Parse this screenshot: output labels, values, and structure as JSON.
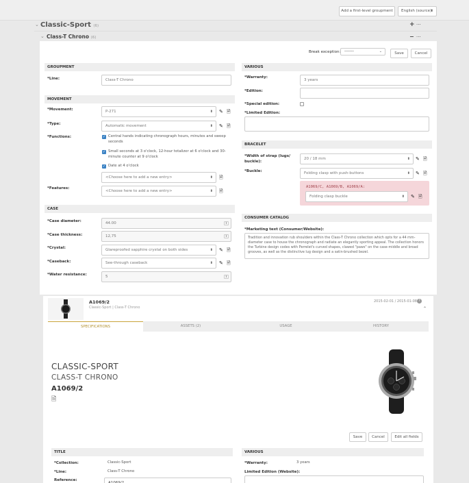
{
  "toolbar": {
    "add_groupment": "Add a first-level groupment",
    "language": "English (source)"
  },
  "tree": {
    "root_label": "Classic-Sport",
    "root_count": "(6)",
    "child_label": "Class-T Chrono",
    "child_count": "(6)",
    "plus": "+",
    "dots": "···",
    "minus": "−"
  },
  "form": {
    "break_exception_label": "Break exception:",
    "break_exception_value": "-------",
    "save": "Save",
    "cancel": "Cancel",
    "groupment": {
      "title": "GROUPMENT",
      "line_label": "*Line:",
      "line_value": "Class-T Chrono"
    },
    "movement": {
      "title": "MOVEMENT",
      "movement_label": "*Movement:",
      "movement_value": "P-271",
      "type_label": "*Type:",
      "type_value": "Automatic movement",
      "functions_label": "*Functions:",
      "functions": [
        "Central hands indicating chronograph hours, minutes and sweep seconds",
        "Small seconds at 3 o'clock, 12-hour totalizer at 6 o'clock and 30-minute counter at 9 o'clock",
        "Date at 4 o'clock"
      ],
      "functions_placeholder": "<Choose here to add a new entry>",
      "features_label": "*Features:",
      "features_placeholder": "<Choose here to add a new entry>"
    },
    "case": {
      "title": "CASE",
      "diameter_label": "*Case diameter:",
      "diameter_value": "44.00",
      "thickness_label": "*Case thickness:",
      "thickness_value": "12,75",
      "crystal_label": "*Crystal:",
      "crystal_value": "Glareproofed sapphire crystal on both sides",
      "caseback_label": "*Caseback:",
      "caseback_value": "See-through caseback",
      "water_label": "*Water resistance:",
      "water_value": "5"
    },
    "various": {
      "title": "VARIOUS",
      "warranty_label": "*Warranty:",
      "warranty_value": "3 years",
      "edition_label": "*Edition:",
      "special_label": "*Special edition:",
      "limited_label": "*Limited Edition:"
    },
    "bracelet": {
      "title": "BRACELET",
      "width_label": "*Width of strap (lugs/ buckle):",
      "width_value": "20 / 18 mm",
      "buckle_label": "*Buckle:",
      "buckle_value": "Folding clasp with push-buttons",
      "exception_refs": "A1069/C, A1069/B, A1069/A:",
      "exception_value": "Folding clasp buckle"
    },
    "consumer": {
      "title": "CONSUMER CATALOG",
      "marketing_label": "*Marketing text (Consumer/Website):",
      "marketing_text": "Tradition and innovation rub shoulders within the Class-T Chrono collection which opts for a 44 mm-diameter case to house the chronograph and radiate an elegantly sporting appeal. The collection honors the Turbine design codes with Perrelet's curved shapes, clawed \"paws\" on the case-middle and broad grooves, as well as the distinctive lug design and a satin-brushed bezel."
    }
  },
  "product": {
    "ref": "A1069/2",
    "breadcrumb": "Classic-Sport | Class-T Chrono",
    "dates": "2015-02-01 / 2015-01-08",
    "tabs": [
      {
        "label": "SPECIFICATIONS"
      },
      {
        "label": "ASSETS (2)"
      },
      {
        "label": "USAGE"
      },
      {
        "label": "HISTORY"
      }
    ],
    "headline_collection": "CLASSIC-SPORT",
    "headline_line": "CLASS-T CHRONO",
    "headline_ref": "A1069/2",
    "save": "Save",
    "cancel": "Cancel",
    "edit_all": "Edit all fields",
    "title_section": {
      "title": "TITLE",
      "collection_label": "*Collection:",
      "collection_value": "Classic-Sport",
      "line_label": "*Line:",
      "line_value": "Class-T Chrono",
      "reference_label": "Reference:",
      "reference_value": "A1069/2"
    },
    "various_section": {
      "title": "VARIOUS",
      "warranty_label": "*Warranty:",
      "warranty_value": "3 years",
      "limited_label": "Limited Edition (Website):"
    }
  },
  "colors": {
    "accent": "#3b82c4",
    "exception_bg": "#f5d6da",
    "tab_active": "#c9a43a"
  }
}
